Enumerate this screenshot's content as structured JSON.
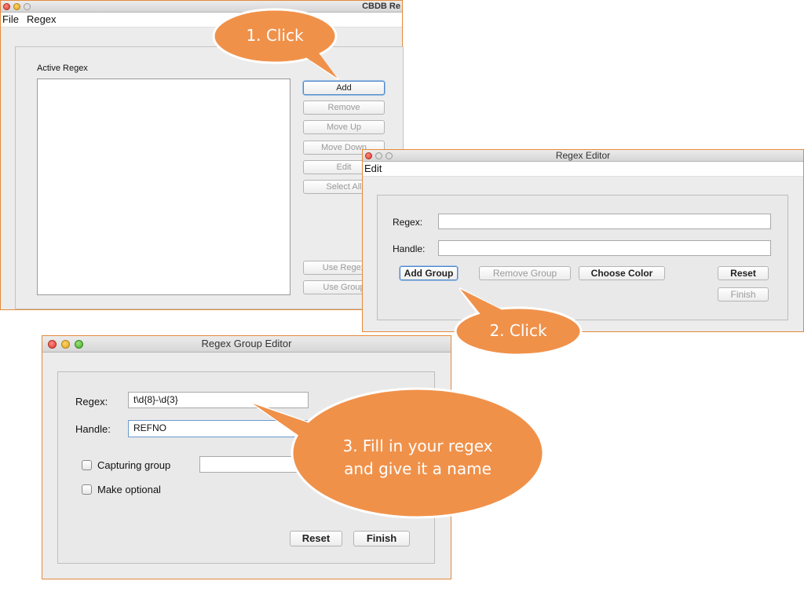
{
  "main_window": {
    "title": "CBDB Re",
    "menu": [
      "File",
      "Regex"
    ],
    "active_regex_label": "Active Regex",
    "buttons": {
      "add": "Add",
      "remove": "Remove",
      "move_up": "Move Up",
      "move_down": "Move Down",
      "edit": "Edit",
      "select_all": "Select All",
      "use_regex": "Use Regex",
      "use_group": "Use Group"
    }
  },
  "regex_editor": {
    "title": "Regex Editor",
    "menu": [
      "Edit"
    ],
    "regex_label": "Regex:",
    "regex_value": "",
    "handle_label": "Handle:",
    "handle_value": "",
    "buttons": {
      "add_group": "Add Group",
      "remove_group": "Remove Group",
      "choose_color": "Choose Color",
      "reset": "Reset",
      "finish": "Finish"
    }
  },
  "group_editor": {
    "title": "Regex Group Editor",
    "regex_label": "Regex:",
    "regex_value": "t\\d{8}-\\d{3}",
    "handle_label": "Handle:",
    "handle_value": "REFNO",
    "capturing_group_label": "Capturing group",
    "make_optional_label": "Make optional",
    "buttons": {
      "reset": "Reset",
      "finish": "Finish"
    }
  },
  "callouts": {
    "step1": "1. Click",
    "step2": "2. Click",
    "step3_line1": "3. Fill in your regex",
    "step3_line2": "and give it a name"
  },
  "colors": {
    "callout": "#f0914a",
    "frame": "#e58a3a",
    "focus": "#4d87c7"
  }
}
